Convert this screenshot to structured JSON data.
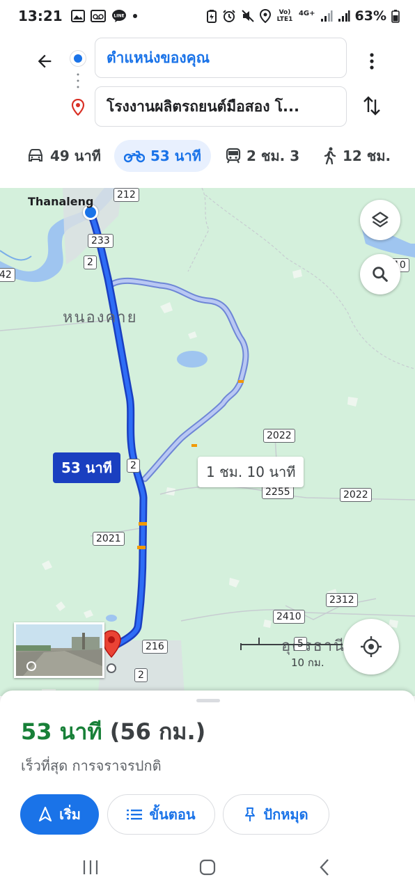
{
  "status_bar": {
    "time": "13:21",
    "left_icons": [
      "gallery-icon",
      "voicemail-icon",
      "line-icon",
      "dot-icon"
    ],
    "right_icons": [
      "battery-saver-icon",
      "alarm-icon",
      "mute-icon",
      "location-icon",
      "volte-icon",
      "signal-icon",
      "signal-icon"
    ],
    "volte_text": "Vo) LTE1",
    "network": "4G+",
    "battery": "63%"
  },
  "header": {
    "origin": "ตำแหน่งของคุณ",
    "destination": "โรงงานผลิตรถยนต์มือสอง โ..."
  },
  "modes": [
    {
      "icon": "car-icon",
      "label": "49 นาที",
      "active": false
    },
    {
      "icon": "motorcycle-icon",
      "label": "53 นาที",
      "active": true
    },
    {
      "icon": "transit-icon",
      "label": "2 ชม. 3",
      "active": false
    },
    {
      "icon": "walk-icon",
      "label": "12 ชม.",
      "active": false
    }
  ],
  "map": {
    "place_thanaleng": "Thanaleng",
    "place_nongkhai": "หนองคาย",
    "place_udon": "อุดรธานี",
    "roads": {
      "r212": "212",
      "r233": "233",
      "r2a": "2",
      "r42": "42",
      "r2b": "2",
      "r2022a": "2022",
      "r2255": "2255",
      "r2022b": "2022",
      "r2021": "2021",
      "r2312": "2312",
      "r2410": "2410",
      "r216": "216",
      "r2c": "2",
      "r10": "10",
      "r5": "5"
    },
    "route_main_time": "53 นาที",
    "route_alt_time": "1 ชม. 10 นาที",
    "scale_label": "10 กม.",
    "route_color": "#1a3fc0",
    "alt_route_color": "#a6b8f0"
  },
  "sheet": {
    "duration": "53 นาที",
    "distance": "(56 กม.)",
    "subtitle": "เร็วที่สุด การจราจรปกติ",
    "start_label": "เริ่ม",
    "steps_label": "ขั้นตอน",
    "pin_label": "ปักหมุด"
  }
}
